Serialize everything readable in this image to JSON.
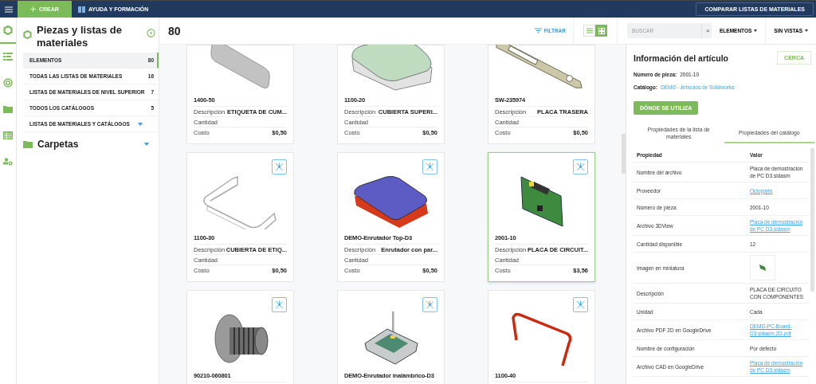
{
  "top_bar": {
    "create_button": "CREAR",
    "help_link": "AYUDA Y FORMACIÓN",
    "compare_button": "COMPARAR LISTAS DE MATERIALES"
  },
  "rail": [
    {
      "kind": "parts",
      "selected": true
    },
    {
      "kind": "list",
      "selected": false
    },
    {
      "kind": "target",
      "selected": false
    },
    {
      "kind": "folder",
      "selected": false
    },
    {
      "kind": "table",
      "selected": false
    },
    {
      "kind": "users",
      "selected": false
    }
  ],
  "sidebar": {
    "title": "Piezas y listas de materiales",
    "items": [
      {
        "label": "ELEMENTOS",
        "count": "80",
        "selected": true,
        "expandable": false
      },
      {
        "label": "TODAS LAS LISTAS DE MATERIALES",
        "count": "16",
        "selected": false,
        "expandable": false
      },
      {
        "label": "LISTAS DE MATERIALES DE NIVEL SUPERIOR",
        "count": "7",
        "selected": false,
        "expandable": false
      },
      {
        "label": "TODOS LOS CATÁLOGOS",
        "count": "5",
        "selected": false,
        "expandable": false
      },
      {
        "label": "LISTAS DE MATERIALES Y CATÁLOGOS",
        "selected": false,
        "expandable": true
      }
    ],
    "folders_heading": "Carpetas"
  },
  "toolbar": {
    "count": "80",
    "filter_link": "FILTRAR",
    "views": [
      {
        "kind": "list",
        "selected": false
      },
      {
        "kind": "grid",
        "selected": true
      }
    ],
    "search": {
      "placeholder": "BUSCAR",
      "clear_button": "×"
    },
    "dropdowns": [
      "ELEMENTOS",
      "SIN VISTAS"
    ]
  },
  "cards": [
    {
      "kind": "plate",
      "title": "1400-50",
      "tree_button": false,
      "selected": false,
      "fields": [
        {
          "label": "Descripción",
          "value": "ETIQUETA DE CUM..."
        },
        {
          "label": "Cantidad"
        },
        {
          "label": "Costo",
          "value": "$0,50"
        }
      ]
    },
    {
      "kind": "cover",
      "title": "1100-20",
      "tree_button": false,
      "selected": false,
      "fields": [
        {
          "label": "Descripción",
          "value": "CUBIERTA SUPERI..."
        },
        {
          "label": "Cantidad"
        },
        {
          "label": "Costo",
          "value": "$0,50"
        }
      ]
    },
    {
      "kind": "bracket",
      "title": "SW-235974",
      "tree_button": false,
      "selected": false,
      "fields": [
        {
          "label": "Descripción",
          "value": "PLACA TRASERA"
        },
        {
          "label": "Cantidad"
        },
        {
          "label": "Costo",
          "value": "$0,50"
        }
      ]
    },
    {
      "kind": "frame",
      "title": "1100-30",
      "tree_button": true,
      "selected": false,
      "fields": [
        {
          "label": "Descripción",
          "value": "CUBIERTA DE ETIQ..."
        },
        {
          "label": "Cantidad"
        },
        {
          "label": "Costo",
          "value": "$0,50"
        }
      ]
    },
    {
      "kind": "enclosure",
      "title": "DEMO-Enrutador Top-D3",
      "tree_button": true,
      "selected": false,
      "fields": [
        {
          "label": "Descripción",
          "value": "Enrutador con par..."
        },
        {
          "label": "Cantidad"
        },
        {
          "label": "Costo",
          "value": "$0,50"
        }
      ]
    },
    {
      "kind": "board",
      "title": "2001-10",
      "tree_button": true,
      "selected": true,
      "fields": [
        {
          "label": "Descripción",
          "value": "PLACA DE CIRCUIT..."
        },
        {
          "label": "Cantidad"
        },
        {
          "label": "Costo",
          "value": "$3,56"
        }
      ]
    },
    {
      "kind": "screw",
      "title": "90210-060801",
      "tree_button": true,
      "selected": false
    },
    {
      "kind": "router",
      "title": "DEMO-Enrutador inalámbrico-D3",
      "tree_button": true,
      "selected": false
    },
    {
      "kind": "strap",
      "title": "1100-40",
      "tree_button": true,
      "selected": false
    }
  ],
  "info_panel": {
    "title": "Información del artículo",
    "close_button": "CERCA",
    "part_number_label": "Número de pieza:",
    "part_number": "2001-10",
    "catalog_label": "Catálogo:",
    "catalog_link": "DEMO - Artículos de Solidworks",
    "where_used_button": "DÓNDE SE UTILIZA",
    "tabs": [
      {
        "label": "Propiedades de la lista de materiales",
        "selected": false
      },
      {
        "label": "Propiedades del catálogo",
        "selected": true
      }
    ],
    "columns": [
      "Propiedad",
      "Valor"
    ],
    "rows": [
      {
        "kind": "text",
        "property": "Nombre del archivo",
        "value": "Placa de demostración de PC D3.sldasm"
      },
      {
        "kind": "link",
        "property": "Proveedor",
        "value": "Octoparte"
      },
      {
        "kind": "text",
        "property": "Número de pieza",
        "value": "2001-10"
      },
      {
        "kind": "link",
        "property": "Archivo 3DView",
        "value": "Placa de demostración de PC D3.sldasm"
      },
      {
        "kind": "text",
        "property": "Cantidad disponible",
        "value": "12"
      },
      {
        "kind": "image",
        "property": "Imagen en miniatura"
      },
      {
        "kind": "text",
        "property": "Descripción",
        "value": "PLACA DE CIRCUITO CON COMPONENTES"
      },
      {
        "kind": "text",
        "property": "Unidad",
        "value": "Cada"
      },
      {
        "kind": "link",
        "property": "Archivo PDF 2D en GoogleDrive",
        "value": "DEMO-PC-Board-D3.sldasm.2D.pdf"
      },
      {
        "kind": "text",
        "property": "Nombre de configuración",
        "value": "Por defecto"
      },
      {
        "kind": "link",
        "property": "Archivo CAD en GoogleDrive",
        "value": "Placa de demostración de PC D3.sldasm"
      }
    ]
  }
}
